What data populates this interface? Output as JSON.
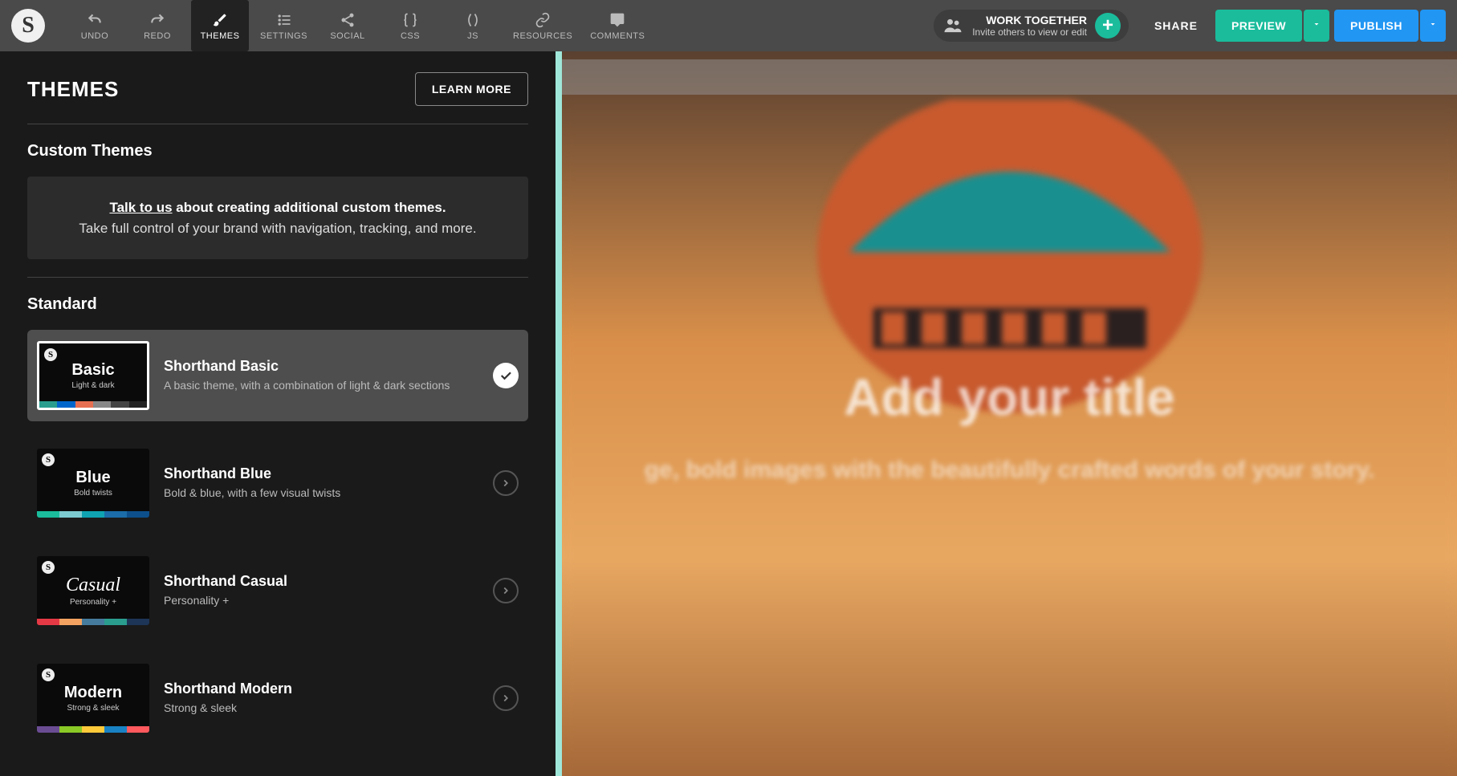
{
  "toolbar": {
    "undo": "UNDO",
    "redo": "REDO",
    "themes": "THEMES",
    "settings": "SETTINGS",
    "social": "SOCIAL",
    "css": "CSS",
    "js": "JS",
    "resources": "RESOURCES",
    "comments": "COMMENTS"
  },
  "collab": {
    "title": "WORK TOGETHER",
    "subtitle": "Invite others to view or edit"
  },
  "share": "SHARE",
  "preview": "PREVIEW",
  "publish": "PUBLISH",
  "panel": {
    "title": "THEMES",
    "learn_more": "LEARN MORE",
    "custom_heading": "Custom Themes",
    "cta_link": "Talk to us",
    "cta_strong": " about creating additional custom themes.",
    "cta_rest": "Take full control of your brand with navigation, tracking, and more.",
    "standard_heading": "Standard"
  },
  "themes": [
    {
      "thumb_name": "Basic",
      "thumb_sub": "Light & dark",
      "name": "Shorthand Basic",
      "desc": "A basic theme, with a combination of light & dark sections",
      "selected": true,
      "palette": [
        "#2a9d8f",
        "#0066cc",
        "#e76f51",
        "#888888",
        "#444444",
        "#222222"
      ]
    },
    {
      "thumb_name": "Blue",
      "thumb_sub": "Bold twists",
      "name": "Shorthand Blue",
      "desc": "Bold & blue, with a few visual twists",
      "selected": false,
      "palette": [
        "#1abc9c",
        "#7ccbd0",
        "#0fa3b1",
        "#1b6ca8",
        "#0d4f8b"
      ]
    },
    {
      "thumb_name": "Casual",
      "thumb_sub": "Personality +",
      "name": "Shorthand Casual",
      "desc": "Personality +",
      "selected": false,
      "cursive": true,
      "palette": [
        "#e63946",
        "#f4a261",
        "#457b9d",
        "#2a9d8f",
        "#1d3557"
      ]
    },
    {
      "thumb_name": "Modern",
      "thumb_sub": "Strong & sleek",
      "name": "Shorthand Modern",
      "desc": "Strong & sleek",
      "selected": false,
      "palette": [
        "#6a4c93",
        "#8ac926",
        "#ffca3a",
        "#1982c4",
        "#ff595e"
      ]
    }
  ],
  "canvas": {
    "title": "Add your title",
    "subtitle": "ge, bold images with the beautifully crafted words of your story."
  }
}
